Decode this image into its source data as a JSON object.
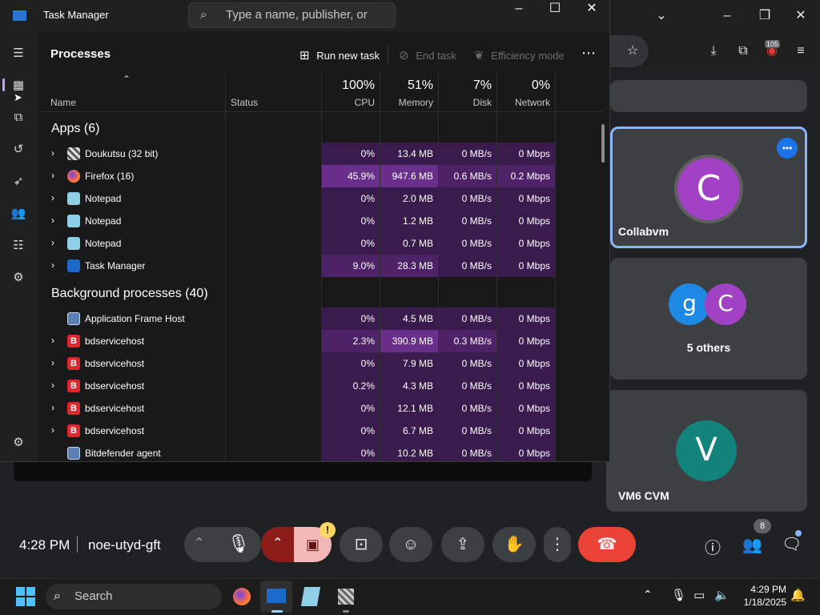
{
  "colors": {
    "heat_low": "#3a1b4d",
    "heat_mid": "#4d2266",
    "heat_high": "#6a2f8a",
    "accent": "#8ab4f8",
    "end_call": "#ea4335"
  },
  "taskmanager": {
    "title": "Task Manager",
    "search_placeholder": "Type a name, publisher, or PID...",
    "heading": "Processes",
    "commands": {
      "run_new_task": "Run new task",
      "end_task": "End task",
      "efficiency_mode": "Efficiency mode"
    },
    "columns": {
      "name": "Name",
      "status": "Status",
      "cpu_pct": "100%",
      "cpu": "CPU",
      "mem_pct": "51%",
      "memory": "Memory",
      "disk_pct": "7%",
      "disk": "Disk",
      "net_pct": "0%",
      "network": "Network"
    },
    "groups": {
      "apps": "Apps (6)",
      "background": "Background processes (40)"
    },
    "apps": [
      {
        "name": "Doukutsu (32 bit)",
        "cpu": "0%",
        "mem": "13.4 MB",
        "disk": "0 MB/s",
        "net": "0 Mbps",
        "icon": "doukutsu-icon"
      },
      {
        "name": "Firefox (16)",
        "cpu": "45.9%",
        "mem": "947.6 MB",
        "disk": "0.6 MB/s",
        "net": "0.2 Mbps",
        "icon": "firefox-icon"
      },
      {
        "name": "Notepad",
        "cpu": "0%",
        "mem": "2.0 MB",
        "disk": "0 MB/s",
        "net": "0 Mbps",
        "icon": "notepad-icon"
      },
      {
        "name": "Notepad",
        "cpu": "0%",
        "mem": "1.2 MB",
        "disk": "0 MB/s",
        "net": "0 Mbps",
        "icon": "notepad-icon"
      },
      {
        "name": "Notepad",
        "cpu": "0%",
        "mem": "0.7 MB",
        "disk": "0 MB/s",
        "net": "0 Mbps",
        "icon": "notepad-icon"
      },
      {
        "name": "Task Manager",
        "cpu": "9.0%",
        "mem": "28.3 MB",
        "disk": "0 MB/s",
        "net": "0 Mbps",
        "icon": "task-manager-icon"
      }
    ],
    "background": [
      {
        "name": "Application Frame Host",
        "cpu": "0%",
        "mem": "4.5 MB",
        "disk": "0 MB/s",
        "net": "0 Mbps",
        "icon": "app-frame-icon"
      },
      {
        "name": "bdservicehost",
        "cpu": "2.3%",
        "mem": "390.9 MB",
        "disk": "0.3 MB/s",
        "net": "0 Mbps",
        "icon": "bitdefender-icon"
      },
      {
        "name": "bdservicehost",
        "cpu": "0%",
        "mem": "7.9 MB",
        "disk": "0 MB/s",
        "net": "0 Mbps",
        "icon": "bitdefender-icon"
      },
      {
        "name": "bdservicehost",
        "cpu": "0.2%",
        "mem": "4.3 MB",
        "disk": "0 MB/s",
        "net": "0 Mbps",
        "icon": "bitdefender-icon"
      },
      {
        "name": "bdservicehost",
        "cpu": "0%",
        "mem": "12.1 MB",
        "disk": "0 MB/s",
        "net": "0 Mbps",
        "icon": "bitdefender-icon"
      },
      {
        "name": "bdservicehost",
        "cpu": "0%",
        "mem": "6.7 MB",
        "disk": "0 MB/s",
        "net": "0 Mbps",
        "icon": "bitdefender-icon"
      },
      {
        "name": "Bitdefender agent",
        "cpu": "0%",
        "mem": "10.2 MB",
        "disk": "0 MB/s",
        "net": "0 Mbps",
        "icon": "app-frame-icon"
      }
    ]
  },
  "meet": {
    "tiles": {
      "collab_initial": "C",
      "collab_name": "Collabvm",
      "others_initial_1": "g",
      "others_initial_2": "C",
      "others_label": "5 others",
      "vm6_initial": "V",
      "vm6_name": "VM6 CVM"
    },
    "time": "4:28 PM",
    "meeting_code": "noe-utyd-gft",
    "people_count": "8",
    "extensions_badge": "105"
  },
  "taskbar": {
    "search": "Search",
    "time": "4:29 PM",
    "date": "1/18/2025"
  }
}
